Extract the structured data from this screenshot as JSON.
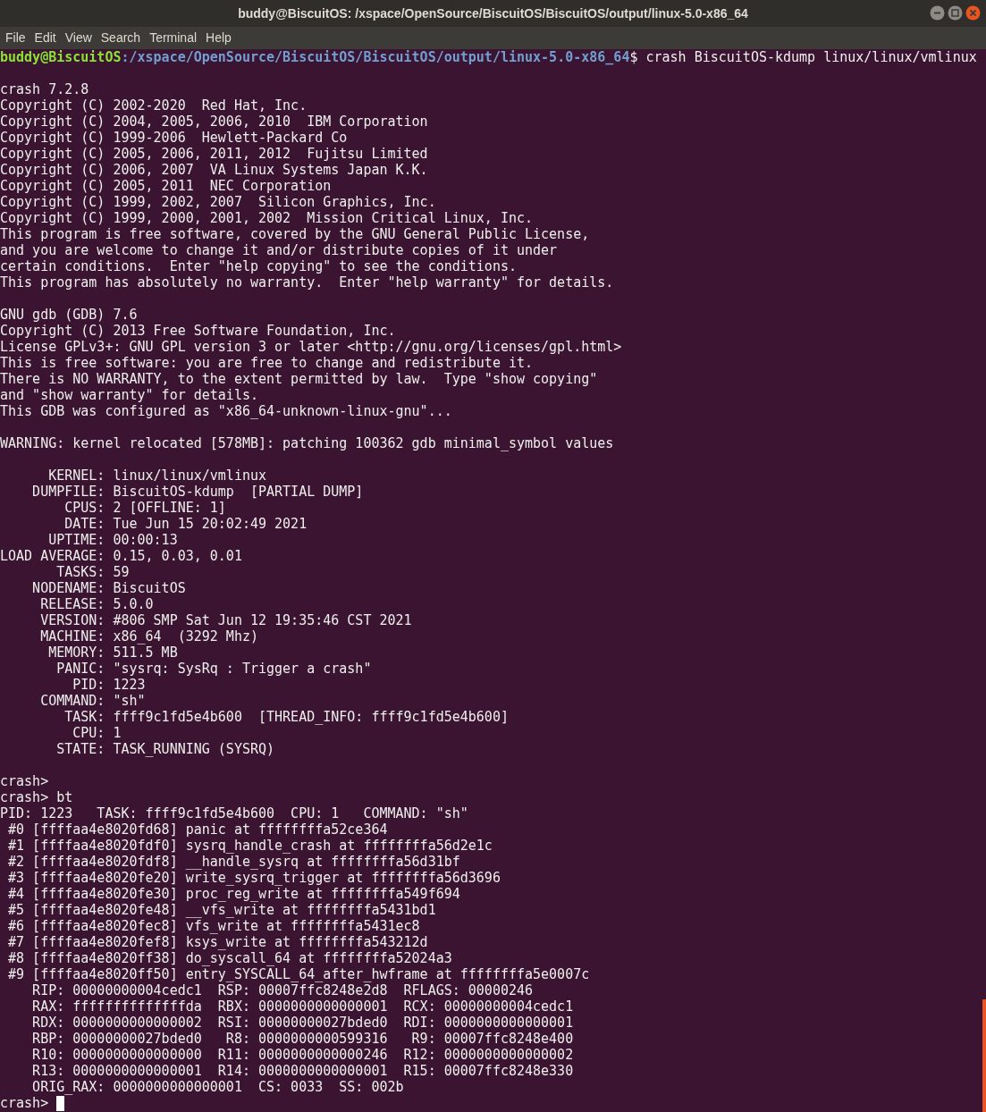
{
  "window": {
    "title": "buddy@BiscuitOS: /xspace/OpenSource/BiscuitOS/BiscuitOS/output/linux-5.0-x86_64"
  },
  "menu": [
    "File",
    "Edit",
    "View",
    "Search",
    "Terminal",
    "Help"
  ],
  "terminal": {
    "prompt": {
      "user_host": "buddy@BiscuitOS",
      "path": ":/xspace/OpenSource/BiscuitOS/BiscuitOS/output/linux-5.0-x86_64",
      "command": "$ crash BiscuitOS-kdump linux/linux/vmlinux"
    },
    "blocks": [
      [
        "crash 7.2.8",
        "Copyright (C) 2002-2020  Red Hat, Inc.",
        "Copyright (C) 2004, 2005, 2006, 2010  IBM Corporation",
        "Copyright (C) 1999-2006  Hewlett-Packard Co",
        "Copyright (C) 2005, 2006, 2011, 2012  Fujitsu Limited",
        "Copyright (C) 2006, 2007  VA Linux Systems Japan K.K.",
        "Copyright (C) 2005, 2011  NEC Corporation",
        "Copyright (C) 1999, 2002, 2007  Silicon Graphics, Inc.",
        "Copyright (C) 1999, 2000, 2001, 2002  Mission Critical Linux, Inc.",
        "This program is free software, covered by the GNU General Public License,",
        "and you are welcome to change it and/or distribute copies of it under",
        "certain conditions.  Enter \"help copying\" to see the conditions.",
        "This program has absolutely no warranty.  Enter \"help warranty\" for details."
      ],
      [
        "GNU gdb (GDB) 7.6",
        "Copyright (C) 2013 Free Software Foundation, Inc.",
        "License GPLv3+: GNU GPL version 3 or later <http://gnu.org/licenses/gpl.html>",
        "This is free software: you are free to change and redistribute it.",
        "There is NO WARRANTY, to the extent permitted by law.  Type \"show copying\"",
        "and \"show warranty\" for details.",
        "This GDB was configured as \"x86_64-unknown-linux-gnu\"..."
      ],
      [
        "WARNING: kernel relocated [578MB]: patching 100362 gdb minimal_symbol values"
      ],
      [
        "      KERNEL: linux/linux/vmlinux",
        "    DUMPFILE: BiscuitOS-kdump  [PARTIAL DUMP]",
        "        CPUS: 2 [OFFLINE: 1]",
        "        DATE: Tue Jun 15 20:02:49 2021",
        "      UPTIME: 00:00:13",
        "LOAD AVERAGE: 0.15, 0.03, 0.01",
        "       TASKS: 59",
        "    NODENAME: BiscuitOS",
        "     RELEASE: 5.0.0",
        "     VERSION: #806 SMP Sat Jun 12 19:35:46 CST 2021",
        "     MACHINE: x86_64  (3292 Mhz)",
        "      MEMORY: 511.5 MB",
        "       PANIC: \"sysrq: SysRq : Trigger a crash\"",
        "         PID: 1223",
        "     COMMAND: \"sh\"",
        "        TASK: ffff9c1fd5e4b600  [THREAD_INFO: ffff9c1fd5e4b600]",
        "         CPU: 1",
        "       STATE: TASK_RUNNING (SYSRQ)"
      ],
      [
        "crash>",
        "crash> bt",
        "PID: 1223   TASK: ffff9c1fd5e4b600  CPU: 1   COMMAND: \"sh\"",
        " #0 [ffffaa4e8020fd68] panic at ffffffffa52ce364",
        " #1 [ffffaa4e8020fdf0] sysrq_handle_crash at ffffffffa56d2e1c",
        " #2 [ffffaa4e8020fdf8] __handle_sysrq at ffffffffa56d31bf",
        " #3 [ffffaa4e8020fe20] write_sysrq_trigger at ffffffffa56d3696",
        " #4 [ffffaa4e8020fe30] proc_reg_write at ffffffffa549f694",
        " #5 [ffffaa4e8020fe48] __vfs_write at ffffffffa5431bd1",
        " #6 [ffffaa4e8020fec8] vfs_write at ffffffffa5431ec8",
        " #7 [ffffaa4e8020fef8] ksys_write at ffffffffa543212d",
        " #8 [ffffaa4e8020ff38] do_syscall_64 at ffffffffa52024a3",
        " #9 [ffffaa4e8020ff50] entry_SYSCALL_64_after_hwframe at ffffffffa5e0007c",
        "    RIP: 00000000004cedc1  RSP: 00007ffc8248e2d8  RFLAGS: 00000246",
        "    RAX: ffffffffffffffda  RBX: 0000000000000001  RCX: 00000000004cedc1",
        "    RDX: 0000000000000002  RSI: 00000000027bded0  RDI: 0000000000000001",
        "    RBP: 00000000027bded0   R8: 0000000000599316   R9: 00007ffc8248e400",
        "    R10: 0000000000000000  R11: 0000000000000246  R12: 0000000000000002",
        "    R13: 0000000000000001  R14: 0000000000000001  R15: 00007ffc8248e330",
        "    ORIG_RAX: 0000000000000001  CS: 0033  SS: 002b"
      ]
    ],
    "input_prompt": "crash>"
  }
}
